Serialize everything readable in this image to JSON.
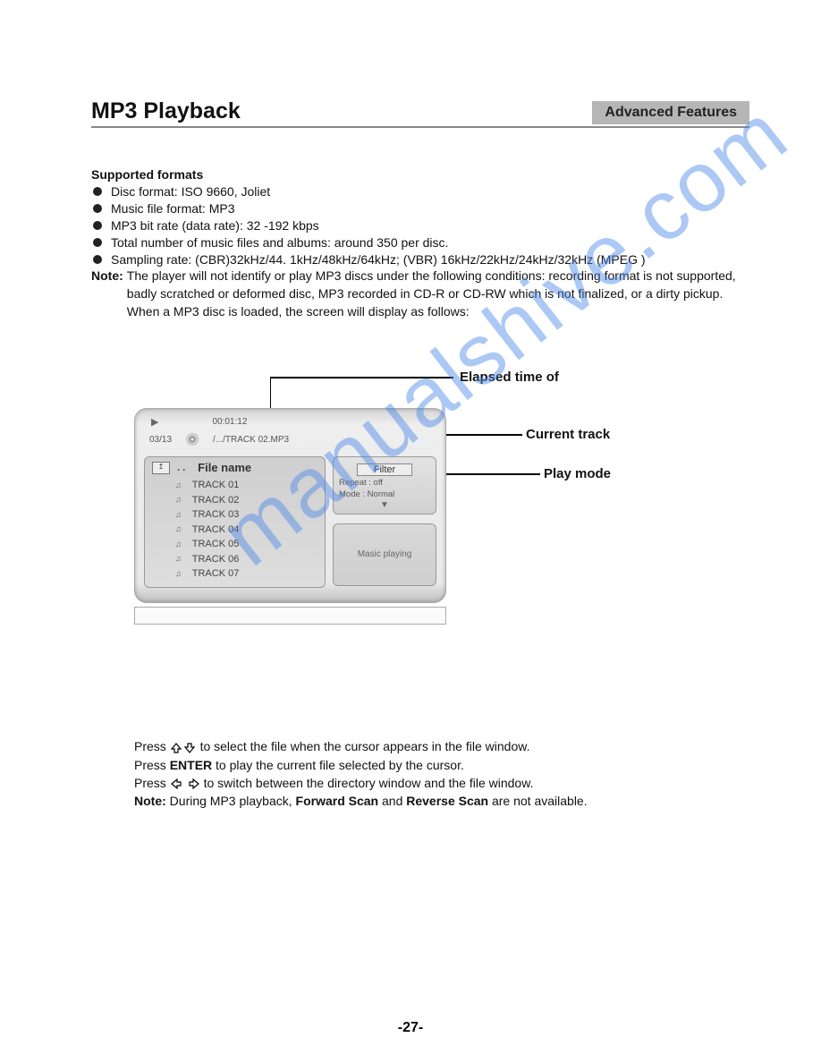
{
  "header": {
    "title": "MP3 Playback",
    "section": "Advanced Features"
  },
  "supported": {
    "heading": "Supported formats",
    "bullets": [
      "Disc format: ISO 9660, Joliet",
      "Music file format: MP3",
      "MP3 bit rate (data rate): 32 -192 kbps",
      "Total number of music files and albums: around 350 per disc.",
      "Sampling rate: (CBR)32kHz/44. 1kHz/48kHz/64kHz; (VBR) 16kHz/22kHz/24kHz/32kHz (MPEG )"
    ],
    "note_label": "Note:",
    "note_body": "The player will not identify or play MP3 discs under the following conditions: recording format is not supported, badly scratched or deformed disc, MP3 recorded in CD-R or CD-RW which is not finalized, or a dirty pickup. When a MP3 disc is loaded, the screen will display as follows:"
  },
  "callouts": {
    "elapsed": "Elapsed time of",
    "current": "Current track",
    "playmode": "Play mode"
  },
  "player": {
    "time": "00:01:12",
    "counter": "03/13",
    "path": "/.../TRACK 02.MP3",
    "file_heading": "File name",
    "tracks": [
      "TRACK 01",
      "TRACK 02",
      "TRACK 03",
      "TRACK 04",
      "TRACK 05",
      "TRACK 06",
      "TRACK 07"
    ],
    "filter_label": "Filter",
    "repeat_row": "Repeat   : off",
    "mode_row": "Mode     : Normal",
    "music_box": "Masic playing"
  },
  "instructions": {
    "lines": [
      {
        "lead": "Press  ",
        "key": "UPDOWN",
        "rest": " to select the file when the cursor appears in the file window."
      },
      {
        "lead": "Press  ",
        "key_bold": "ENTER",
        "rest": " to play the current file selected by the cursor."
      },
      {
        "lead": "Press  ",
        "key": "LEFTRIGHT",
        "rest": " to switch between the directory window and the file window."
      },
      {
        "lead_bold": "Note:  ",
        "rest_a": "During MP3 playback, ",
        "b1": "Forward Scan",
        "mid": " and ",
        "b2": "Reverse Scan",
        "rest_b": " are not available."
      }
    ]
  },
  "page_number": "-27-",
  "watermark": "manualshive.com"
}
